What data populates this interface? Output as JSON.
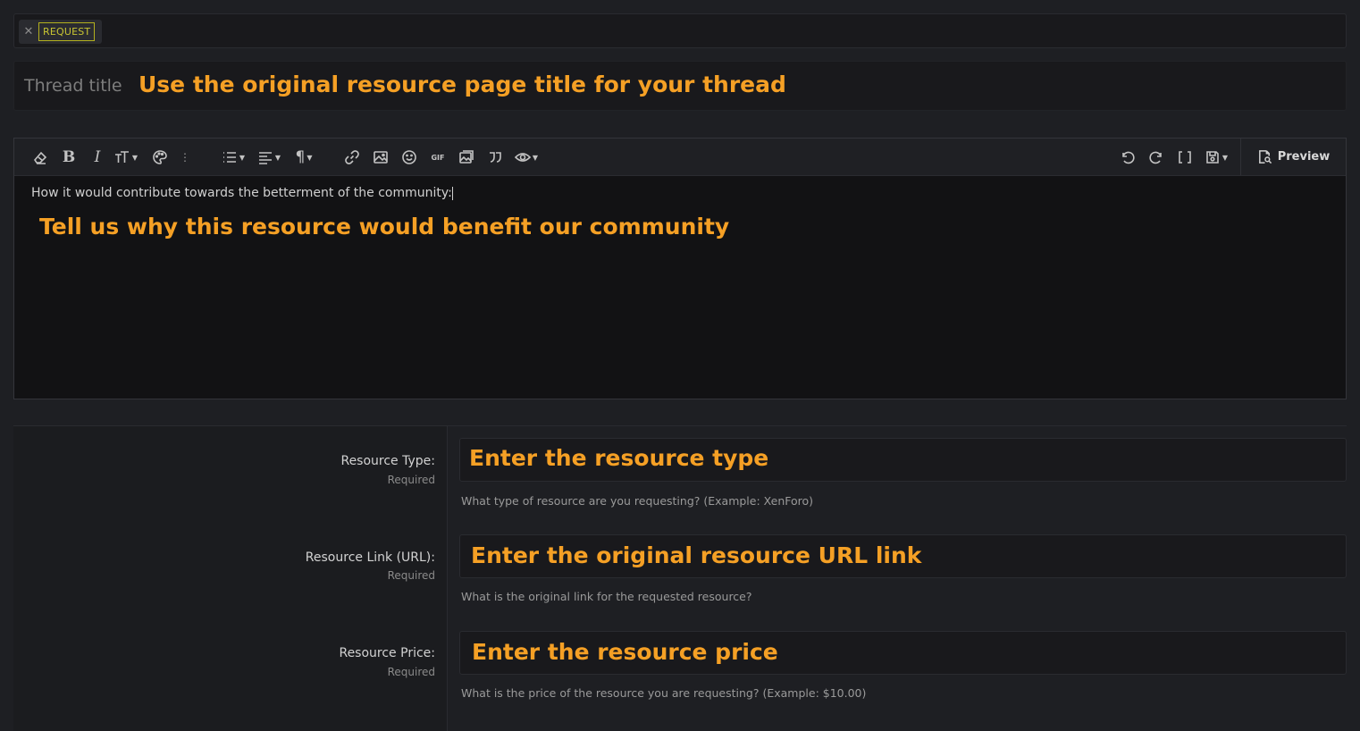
{
  "prefix": {
    "remove_symbol": "✕",
    "label": "REQUEST"
  },
  "thread_title": {
    "placeholder": "Thread title",
    "overlay": "Use the original resource page title for your thread"
  },
  "editor": {
    "toolbar": {
      "bold": "B",
      "italic": "I",
      "paragraph": "¶",
      "gif": "GIF",
      "preview_label": "Preview"
    },
    "content": "How it would contribute towards the betterment of the community:",
    "overlay": "Tell us why this resource would benefit our community"
  },
  "fields": [
    {
      "label": "Resource Type:",
      "required": "Required",
      "overlay": "Enter the resource type",
      "hint": "What type of resource are you requesting? (Example: XenForo)"
    },
    {
      "label": "Resource Link (URL):",
      "required": "Required",
      "overlay": "Enter the original resource URL link",
      "hint": "What is the original link for the requested resource?"
    },
    {
      "label": "Resource Price:",
      "required": "Required",
      "overlay": "Enter the resource price",
      "hint": "What is the price of the resource you are requesting? (Example: $10.00)"
    }
  ],
  "colors": {
    "accent_overlay": "#f5a025",
    "prefix": "#c8c532"
  }
}
